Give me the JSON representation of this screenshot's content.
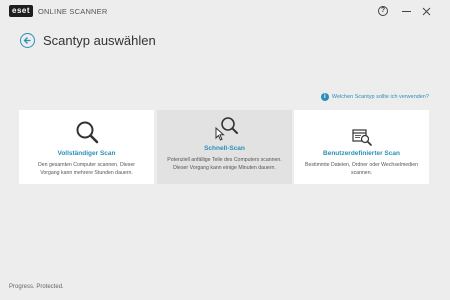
{
  "app": {
    "logo_text": "eset",
    "name": "ONLINE SCANNER"
  },
  "header": {
    "title": "Scantyp auswählen"
  },
  "hint": {
    "text": "Welchen Scantyp sollte ich verwenden?"
  },
  "cards": [
    {
      "title": "Vollständiger Scan",
      "description": "Den gesamten Computer scannen. Dieser Vorgang kann mehrere Stunden dauern.",
      "icon": "magnifier-icon"
    },
    {
      "title": "Schnell-Scan",
      "description": "Potenziell anfällige Teile des Computers scannen. Dieser Vorgang kann einige Minuten dauern.",
      "icon": "magnifier-cursor-icon"
    },
    {
      "title": "Benutzerdefinierter Scan",
      "description": "Bestimmte Dateien, Ordner oder Wechselmedien scannen.",
      "icon": "document-magnifier-icon"
    }
  ],
  "footer": {
    "tagline": "Progress. Protected."
  },
  "colors": {
    "accent": "#2a8fb8",
    "background": "#ededed",
    "card": "#ffffff",
    "card_selected": "#e2e2e2"
  }
}
